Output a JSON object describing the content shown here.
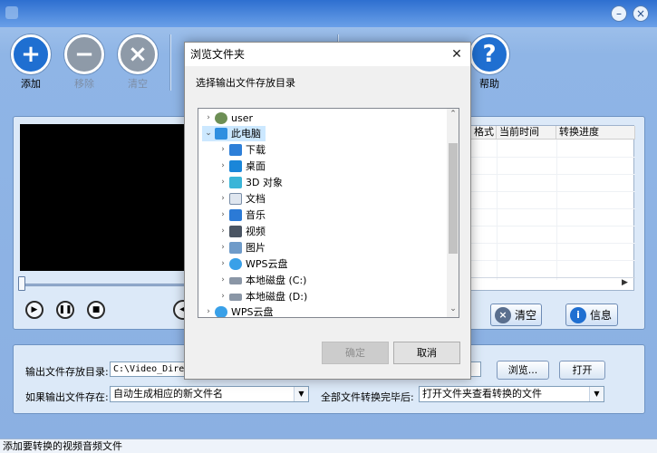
{
  "window": {
    "title": "",
    "buttons": [
      "minimize",
      "close"
    ]
  },
  "toolbar": {
    "items": [
      {
        "label": "添加",
        "icon": "plus-icon",
        "enabled": true
      },
      {
        "label": "移除",
        "icon": "minus-icon",
        "enabled": false
      },
      {
        "label": "清空",
        "icon": "x-icon",
        "enabled": false
      },
      {
        "label": "帮助",
        "icon": "help-icon",
        "enabled": true
      }
    ],
    "colors": {
      "add": "#1f6fd1",
      "remove": "#8e9aa8",
      "clear": "#8e9aa8",
      "help": "#1f6fd1"
    }
  },
  "grid": {
    "columns": [
      "格式",
      "当前时间",
      "转换进度"
    ]
  },
  "actions": {
    "clear": "清空",
    "info": "信息"
  },
  "output": {
    "dir_label": "输出文件存放目录:",
    "dir_value": "C:\\Video_Directo",
    "browse": "浏览...",
    "open": "打开",
    "exists_label": "如果输出文件存在:",
    "exists_value": "自动生成相应的新文件名",
    "done_label": "全部文件转换完毕后:",
    "done_value": "打开文件夹查看转换的文件"
  },
  "status": "添加要转换的视频音频文件",
  "dialog": {
    "title": "浏览文件夹",
    "prompt": "选择输出文件存放目录",
    "ok": "确定",
    "cancel": "取消",
    "tree": [
      {
        "label": "user",
        "icon": "user-icon",
        "level": 0,
        "expanded": false
      },
      {
        "label": "此电脑",
        "icon": "computer-icon",
        "level": 0,
        "expanded": true,
        "selected": true
      },
      {
        "label": "下载",
        "icon": "download-icon",
        "level": 1
      },
      {
        "label": "桌面",
        "icon": "desktop-icon",
        "level": 1
      },
      {
        "label": "3D 对象",
        "icon": "cube-icon",
        "level": 1
      },
      {
        "label": "文档",
        "icon": "document-icon",
        "level": 1
      },
      {
        "label": "音乐",
        "icon": "music-icon",
        "level": 1
      },
      {
        "label": "视频",
        "icon": "video-icon",
        "level": 1
      },
      {
        "label": "图片",
        "icon": "picture-icon",
        "level": 1
      },
      {
        "label": "WPS云盘",
        "icon": "cloud-icon",
        "level": 1
      },
      {
        "label": "本地磁盘 (C:)",
        "icon": "drive-icon",
        "level": 1
      },
      {
        "label": "本地磁盘 (D:)",
        "icon": "drive-icon",
        "level": 1
      },
      {
        "label": "WPS云盘",
        "icon": "cloud-icon",
        "level": 0
      }
    ]
  }
}
